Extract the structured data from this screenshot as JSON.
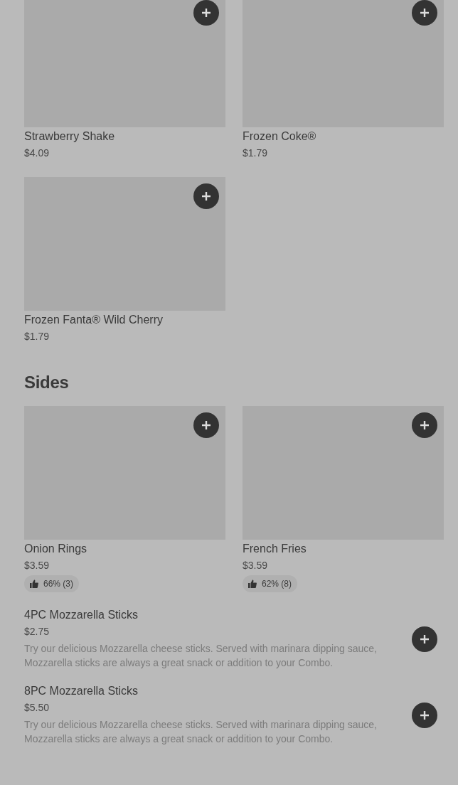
{
  "sections": [
    {
      "items": [
        {
          "kind": "card",
          "name": "Strawberry Shake",
          "price": "$4.09"
        },
        {
          "kind": "card",
          "name": "Frozen Coke®",
          "price": "$1.79"
        },
        {
          "kind": "card",
          "name": "Frozen Fanta® Wild Cherry",
          "price": "$1.79"
        }
      ]
    },
    {
      "title": "Sides",
      "items": [
        {
          "kind": "card",
          "name": "Onion Rings",
          "price": "$3.59",
          "rating": "66% (3)"
        },
        {
          "kind": "card",
          "name": "French Fries",
          "price": "$3.59",
          "rating": "62% (8)"
        },
        {
          "kind": "row",
          "name": "4PC Mozzarella Sticks",
          "price": "$2.75",
          "description": "Try our delicious Mozzarella cheese sticks. Served with marinara dipping sauce, Mozzarella sticks are always a great snack or addition to your Combo."
        },
        {
          "kind": "row",
          "name": "8PC Mozzarella Sticks",
          "price": "$5.50",
          "description": "Try our delicious Mozzarella cheese sticks. Served with marinara dipping sauce, Mozzarella sticks are always a great snack or addition to your Combo."
        }
      ]
    }
  ]
}
